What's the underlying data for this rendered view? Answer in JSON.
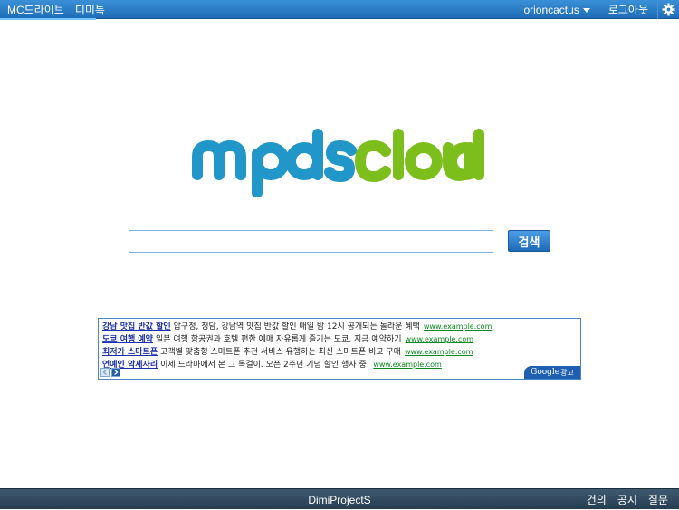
{
  "topbar": {
    "nav": [
      {
        "label": "MC드라이브"
      },
      {
        "label": "디미톡"
      }
    ],
    "username": "orioncactus",
    "logout_label": "로그아웃",
    "settings_icon": "gear-icon"
  },
  "logo": {
    "part1": "mpds",
    "part2": "cloud",
    "colors": {
      "mpds": "#2196c9",
      "cloud": "#7cbf1d"
    }
  },
  "search": {
    "value": "",
    "placeholder": "",
    "button_label": "검색"
  },
  "ads": {
    "items": [
      {
        "title": "강남 맛집 반값 할인",
        "desc": "압구정, 청담, 강남역 맛집 반값 할인 매일 밤 12시 공개되는 놀라운 혜택",
        "url": "www.example.com"
      },
      {
        "title": "도쿄 여행 예약",
        "desc": "일본 여행 항공권과 호텔 편한 예매 자유롭게 즐기는 도쿄, 지금 예약하기",
        "url": "www.example.com"
      },
      {
        "title": "최저가 스마트폰",
        "desc": "고객별 맞춤형 스마트폰 추천 서비스 유행하는 최신 스마트폰 비교 구매",
        "url": "www.example.com"
      },
      {
        "title": "연예인 악세사리",
        "desc": "이제 드라마에서 본 그 목걸이. 오픈 2주년 기념 할인 행사 중!",
        "url": "www.example.com"
      }
    ],
    "badge": {
      "brand": "Google",
      "suffix": "광고"
    },
    "nav_icons": [
      "chevron-left-icon",
      "chevron-right-icon"
    ]
  },
  "footer": {
    "center": "DimiProjectS",
    "links": [
      {
        "label": "건의"
      },
      {
        "label": "공지"
      },
      {
        "label": "질문"
      }
    ]
  }
}
